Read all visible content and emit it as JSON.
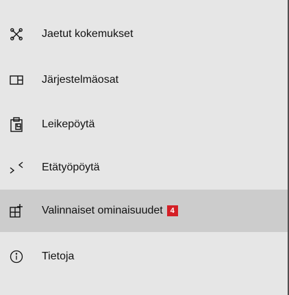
{
  "nav": {
    "items": [
      {
        "label": "Jaetut kokemukset",
        "icon": "shared-experiences-icon"
      },
      {
        "label": "Järjestelmäosat",
        "icon": "system-components-icon"
      },
      {
        "label": "Leikepöytä",
        "icon": "clipboard-icon"
      },
      {
        "label": "Etätyöpöytä",
        "icon": "remote-desktop-icon"
      },
      {
        "label": "Valinnaiset ominaisuudet",
        "icon": "optional-features-icon",
        "badge": "4",
        "selected": true
      },
      {
        "label": "Tietoja",
        "icon": "info-icon"
      }
    ]
  },
  "colors": {
    "background": "#e6e6e6",
    "selected_background": "#cccccc",
    "badge": "#d41f26",
    "border": "#505050"
  }
}
